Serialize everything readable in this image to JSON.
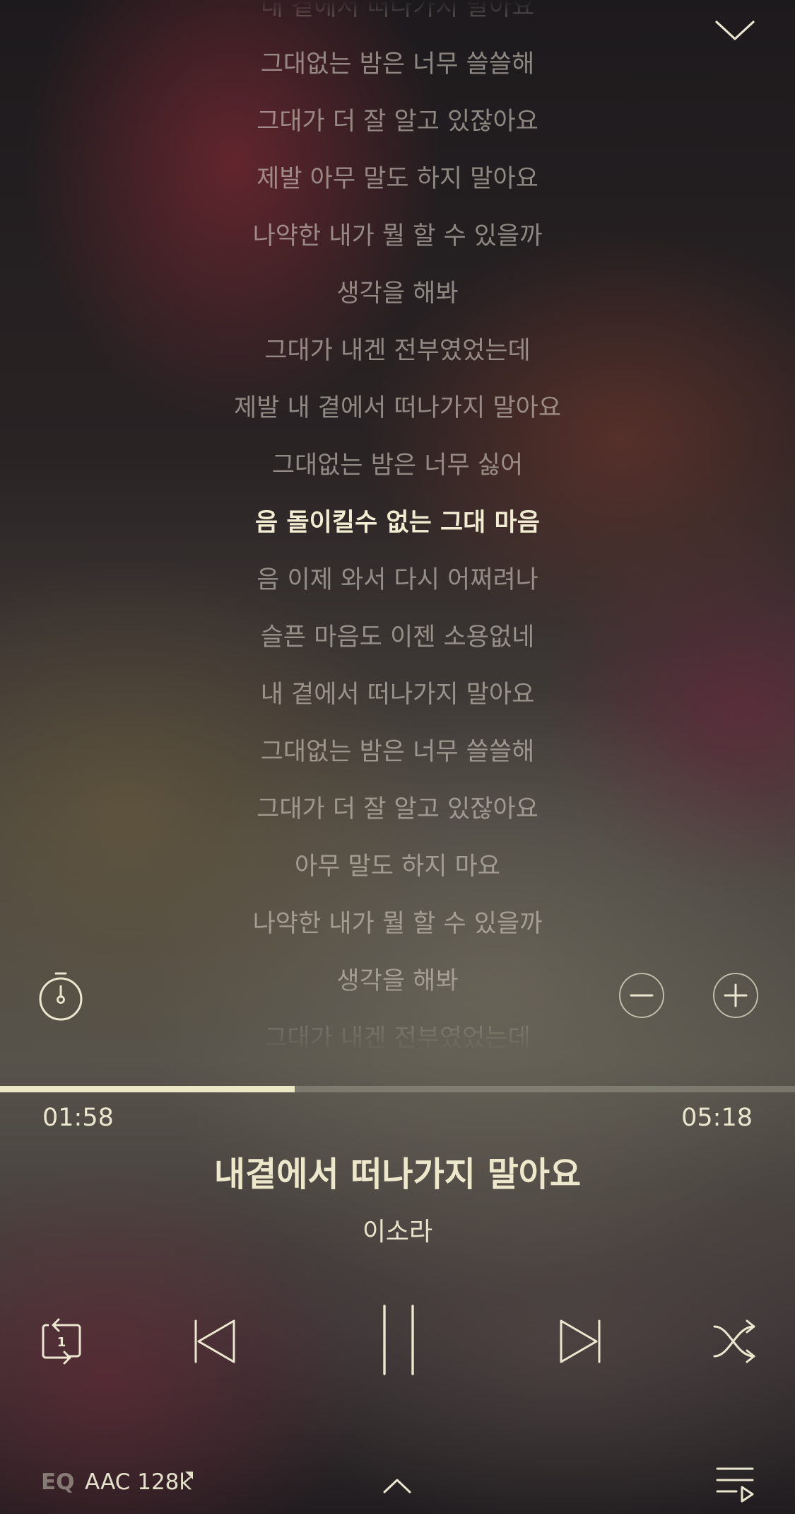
{
  "lyrics": {
    "lines": [
      "내 곁에서 떠나가지 말아요",
      "그대없는 밤은 너무 쓸쓸해",
      "그대가 더 잘 알고 있잖아요",
      "제발 아무 말도 하지 말아요",
      "나약한 내가 뭘 할 수 있을까",
      "생각을 해봐",
      "그대가 내겐 전부였었는데",
      "제발 내 곁에서 떠나가지 말아요",
      "그대없는 밤은 너무 싫어",
      "음 돌이킬수 없는 그대 마음",
      "음 이제 와서 다시 어쩌려나",
      "슬픈 마음도 이젠 소용없네",
      "내 곁에서 떠나가지 말아요",
      "그대없는 밤은 너무 쓸쓸해",
      "그대가 더 잘 알고 있잖아요",
      "아무 말도 하지 마요",
      "나약한 내가 뭘 할 수 있을까",
      "생각을 해봐",
      "그대가 내겐 전부였었는데"
    ],
    "current_index": 9
  },
  "player": {
    "elapsed": "01:58",
    "duration": "05:18",
    "progress_fraction": 0.371
  },
  "track": {
    "title": "내곁에서 떠나가지 말아요",
    "artist": "이소라"
  },
  "footer": {
    "eq_label": "EQ",
    "quality_label": "AAC 128k"
  },
  "icons": {
    "collapse": "chevron-down-icon",
    "timer": "stopwatch-icon",
    "font_smaller": "minus-icon",
    "font_larger": "plus-icon",
    "repeat": "repeat-one-icon",
    "previous": "previous-icon",
    "pause": "pause-icon",
    "next": "next-icon",
    "shuffle": "shuffle-icon",
    "expand": "chevron-up-icon",
    "playlist": "playlist-icon"
  },
  "colors": {
    "accent": "#ece7c4",
    "lyric_dim": "#d0c8be",
    "lyric_current": "#f1ecd2"
  }
}
